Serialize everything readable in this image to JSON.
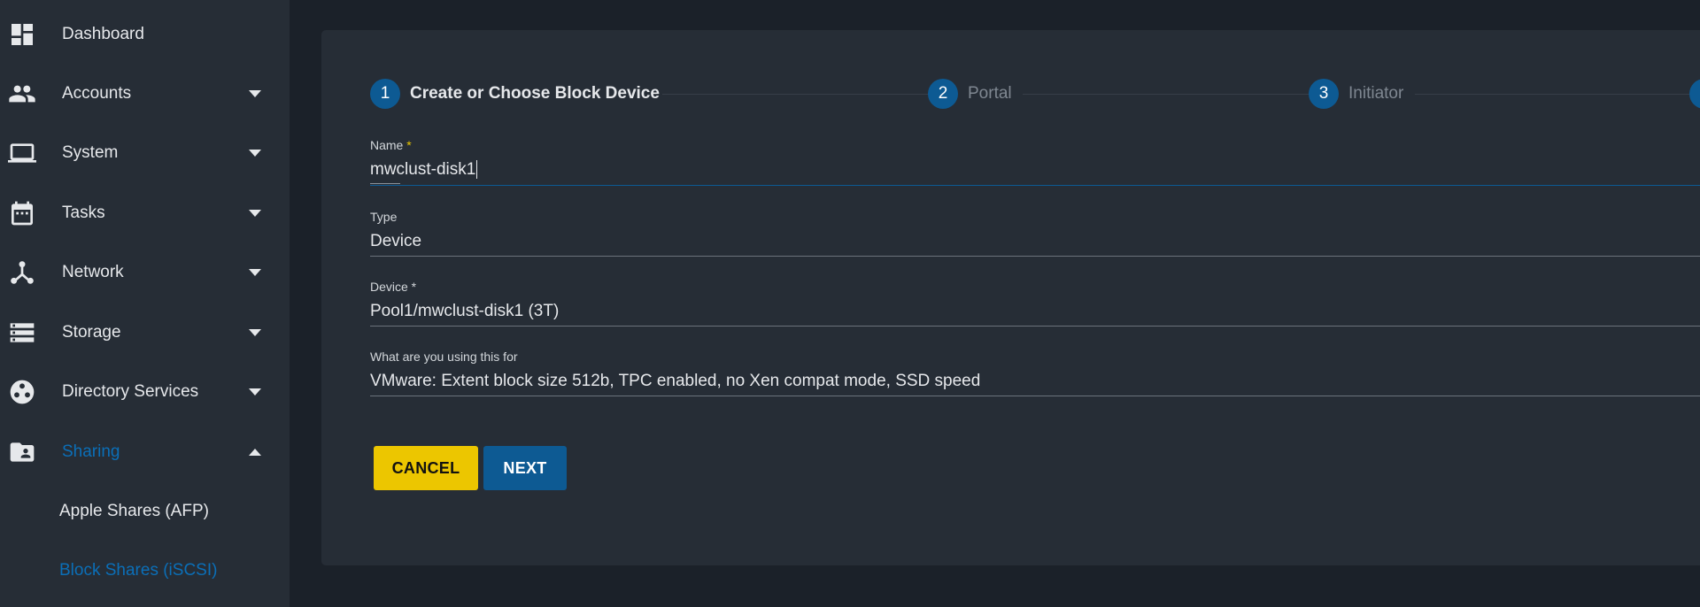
{
  "sidebar": {
    "items": [
      {
        "label": "Dashboard",
        "icon": "dashboard-icon"
      },
      {
        "label": "Accounts",
        "icon": "people-icon"
      },
      {
        "label": "System",
        "icon": "laptop-icon"
      },
      {
        "label": "Tasks",
        "icon": "calendar-icon"
      },
      {
        "label": "Network",
        "icon": "network-icon"
      },
      {
        "label": "Storage",
        "icon": "storage-icon"
      },
      {
        "label": "Directory Services",
        "icon": "directory-icon"
      },
      {
        "label": "Sharing",
        "icon": "folder-shared-icon"
      }
    ],
    "sub_items": [
      {
        "label": "Apple Shares (AFP)"
      },
      {
        "label": "Block Shares (iSCSI)"
      }
    ]
  },
  "stepper": {
    "steps": [
      {
        "number": "1",
        "label": "Create or Choose Block Device"
      },
      {
        "number": "2",
        "label": "Portal"
      },
      {
        "number": "3",
        "label": "Initiator"
      }
    ]
  },
  "form": {
    "name": {
      "label": "Name",
      "required_mark": "*",
      "value": "mwclust-disk1"
    },
    "type": {
      "label": "Type",
      "value": "Device"
    },
    "device": {
      "label": "Device *",
      "value": "Pool1/mwclust-disk1 (3T)"
    },
    "usage": {
      "label": "What are you using this for",
      "value": "VMware: Extent block size 512b, TPC enabled, no Xen compat mode, SSD speed"
    }
  },
  "buttons": {
    "cancel": "CANCEL",
    "next": "NEXT"
  },
  "colors": {
    "accent_blue": "#0d5a93",
    "active_link": "#0b6fb8",
    "warning_yellow": "#ecc600",
    "background": "#1b2129",
    "panel": "#262d36"
  }
}
